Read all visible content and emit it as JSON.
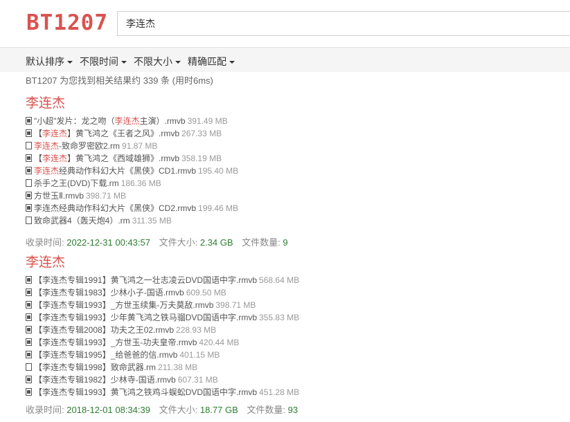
{
  "header": {
    "logo": "BT1207",
    "search_value": "李连杰"
  },
  "filters": [
    {
      "label": "默认排序"
    },
    {
      "label": "不限时间"
    },
    {
      "label": "不限大小"
    },
    {
      "label": "精确匹配"
    }
  ],
  "stats": "BT1207 为您找到相关结果约 339 条 (用时6ms)",
  "results": [
    {
      "title": "李连杰",
      "files": [
        {
          "icon": "film-file-icon",
          "pre": "\"小超\"发片：龙之吻（",
          "hl": "李连杰",
          "post": "主演）.rmvb",
          "size": "391.49 MB"
        },
        {
          "icon": "film-file-icon",
          "pre": "【",
          "hl": "李连杰",
          "post": "】黄飞鸿之《王者之风》.rmvb",
          "size": "267.33 MB"
        },
        {
          "icon": "document-file-icon",
          "pre": "",
          "hl": "李连杰",
          "post": "-致命罗密欧2.rm",
          "size": "91.87 MB"
        },
        {
          "icon": "film-file-icon",
          "pre": "【",
          "hl": "李连杰",
          "post": "】黄飞鸿之《西域雄狮》.rmvb",
          "size": "358.19 MB"
        },
        {
          "icon": "film-file-icon",
          "pre": "",
          "hl": "李连杰",
          "post": "经典动作科幻大片《黑侠》CD1.rmvb",
          "size": "195.40 MB"
        },
        {
          "icon": "document-file-icon",
          "pre": "杀手之王(DVD)下载.rm",
          "hl": "",
          "post": "",
          "size": "186.36 MB"
        },
        {
          "icon": "film-file-icon",
          "pre": "方世玉Ⅱ.rmvb",
          "hl": "",
          "post": "",
          "size": "398.71 MB"
        },
        {
          "icon": "film-file-icon",
          "pre": "李连杰经典动作科幻大片《黑侠》CD2.rmvb",
          "hl": "",
          "post": "",
          "size": "199.46 MB"
        },
        {
          "icon": "document-file-icon",
          "pre": "致命武器4（轰天炮4）.rm",
          "hl": "",
          "post": "",
          "size": "311.35 MB"
        }
      ],
      "meta": {
        "time_label": "收录时间:",
        "time": "2022-12-31 00:43:57",
        "size_label": "文件大小:",
        "size": "2.34 GB",
        "count_label": "文件数量:",
        "count": "9"
      }
    },
    {
      "title": "李连杰",
      "files": [
        {
          "icon": "film-file-icon",
          "pre": "【李连杰专辑1991】黄飞鸿之一壮志凌云DVD国语中字.rmvb",
          "hl": "",
          "post": "",
          "size": "568.64 MB"
        },
        {
          "icon": "film-file-icon",
          "pre": "【李连杰专辑1983】少林小子-国语.rmvb",
          "hl": "",
          "post": "",
          "size": "609.50 MB"
        },
        {
          "icon": "film-file-icon",
          "pre": "【李连杰专辑1993】_方世玉续集-万夫莫敌.rmvb",
          "hl": "",
          "post": "",
          "size": "398.71 MB"
        },
        {
          "icon": "film-file-icon",
          "pre": "【李连杰专辑1993】少年黄飞鸿之铁马骝DVD国语中字.rmvb",
          "hl": "",
          "post": "",
          "size": "355.83 MB"
        },
        {
          "icon": "film-file-icon",
          "pre": "【李连杰专辑2008】功夫之王02.rmvb",
          "hl": "",
          "post": "",
          "size": "228.93 MB"
        },
        {
          "icon": "film-file-icon",
          "pre": "【李连杰专辑1993】_方世玉-功夫皇帝.rmvb",
          "hl": "",
          "post": "",
          "size": "420.44 MB"
        },
        {
          "icon": "film-file-icon",
          "pre": "【李连杰专辑1995】_给爸爸的信.rmvb",
          "hl": "",
          "post": "",
          "size": "401.15 MB"
        },
        {
          "icon": "document-file-icon",
          "pre": "【李连杰专辑1998】致命武器.rm",
          "hl": "",
          "post": "",
          "size": "211.38 MB"
        },
        {
          "icon": "film-file-icon",
          "pre": "【李连杰专辑1982】少林寺-国语.rmvb",
          "hl": "",
          "post": "",
          "size": "607.31 MB"
        },
        {
          "icon": "film-file-icon",
          "pre": "【李连杰专辑1993】黄飞鸿之铁鸡斗蜈蚣DVD国语中字.rmvb",
          "hl": "",
          "post": "",
          "size": "451.28 MB"
        }
      ],
      "meta": {
        "time_label": "收录时间:",
        "time": "2018-12-01 08:34:39",
        "size_label": "文件大小:",
        "size": "18.77 GB",
        "count_label": "文件数量:",
        "count": "93"
      }
    }
  ]
}
